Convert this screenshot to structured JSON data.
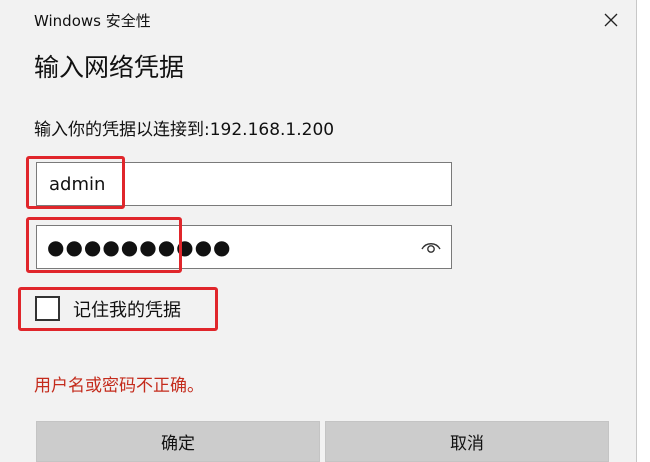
{
  "window": {
    "title": "Windows 安全性"
  },
  "dialog": {
    "heading": "输入网络凭据",
    "description": "输入你的凭据以连接到:192.168.1.200",
    "username": {
      "value": "admin"
    },
    "password": {
      "masked_value": "●●●●●●●●●●"
    },
    "remember": {
      "label": "记住我的凭据",
      "checked": false
    },
    "error": "用户名或密码不正确。",
    "buttons": {
      "ok": "确定",
      "cancel": "取消"
    }
  },
  "icons": {
    "close": "close-icon",
    "reveal_password": "eye-icon"
  },
  "colors": {
    "highlight": "#e0262b",
    "error_text": "#c42b1c",
    "button_bg": "#cccccc"
  }
}
